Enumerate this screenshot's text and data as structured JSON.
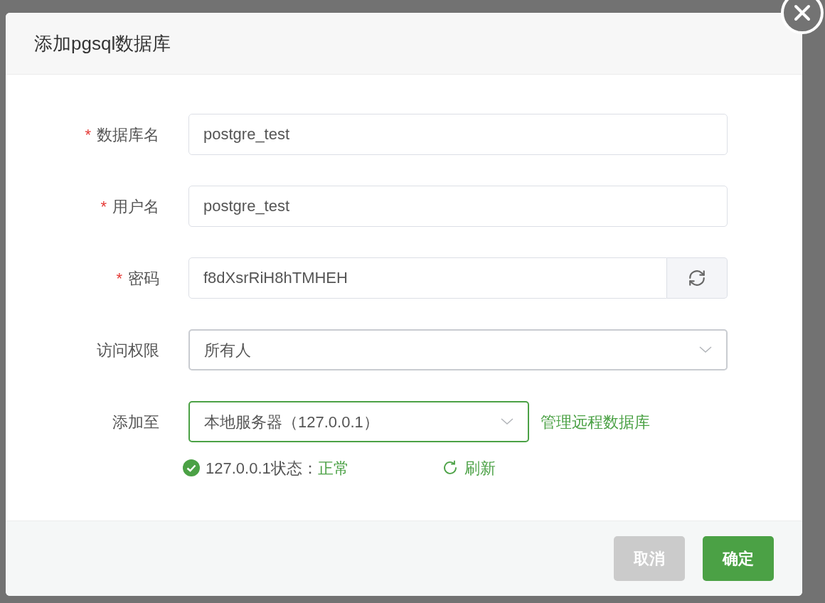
{
  "dialog": {
    "title": "添加pgsql数据库",
    "required_mark": "*",
    "fields": [
      {
        "kind": "text",
        "label": "数据库名",
        "required": true,
        "value": "postgre_test"
      },
      {
        "kind": "text",
        "label": "用户名",
        "required": true,
        "value": "postgre_test"
      },
      {
        "kind": "password",
        "label": "密码",
        "required": true,
        "value": "f8dXsrRiH8hTMHEH"
      },
      {
        "kind": "select",
        "label": "访问权限",
        "required": false,
        "value": "所有人",
        "focused": false
      },
      {
        "kind": "select",
        "label": "添加至",
        "required": false,
        "value": "本地服务器（127.0.0.1）",
        "focused": true,
        "link": "管理远程数据库"
      }
    ],
    "status": {
      "label": "127.0.0.1状态：",
      "value": "正常",
      "refresh": "刷新"
    },
    "buttons": [
      {
        "kind": "cancel",
        "label": "取消"
      },
      {
        "kind": "primary",
        "label": "确定"
      }
    ]
  }
}
